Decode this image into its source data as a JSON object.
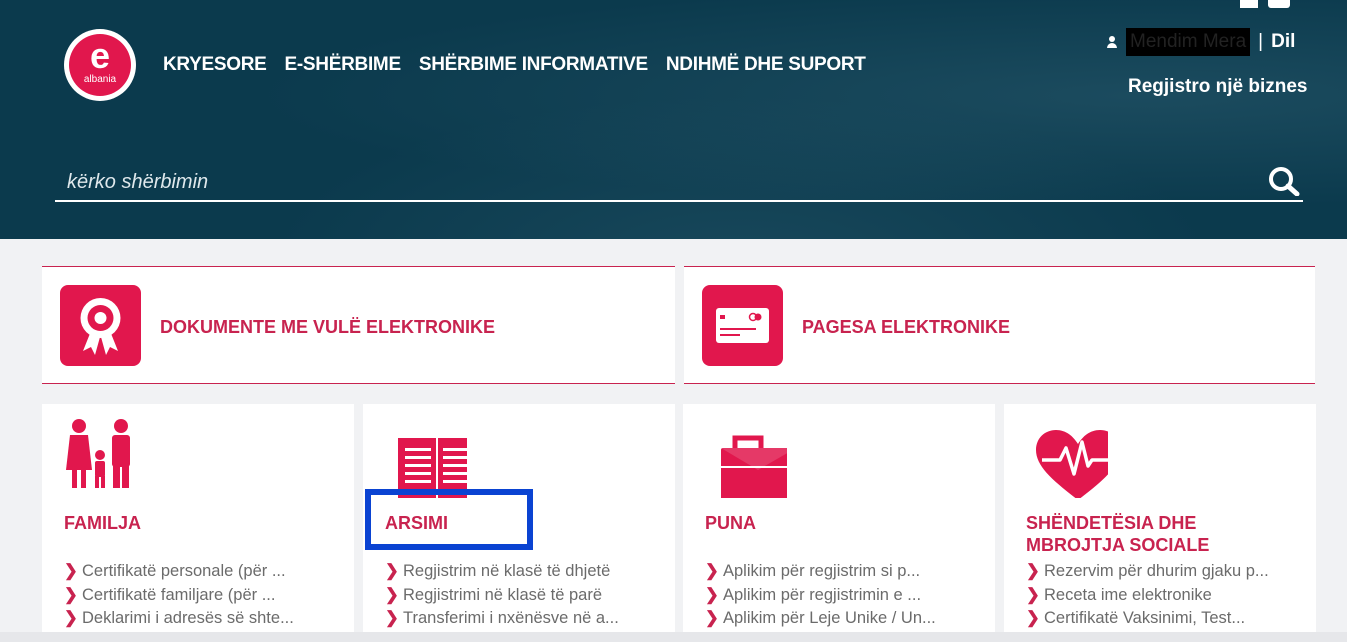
{
  "header": {
    "logo": {
      "letter": "e",
      "sub": "albania"
    },
    "nav": [
      "KRYESORE",
      "E-SHËRBIME",
      "SHËRBIME INFORMATIVE",
      "NDIHMË DHE SUPORT"
    ],
    "user": {
      "name": "Mendim Mera",
      "separator": "|",
      "logout": "Dil"
    },
    "register_business": "Regjistro një biznes",
    "search": {
      "placeholder": "kërko shërbimin"
    }
  },
  "featured": [
    {
      "label": "DOKUMENTE ME VULË ELEKTRONIKE",
      "icon": "ribbon-badge-icon"
    },
    {
      "label": "PAGESA ELEKTRONIKE",
      "icon": "credit-card-icon"
    }
  ],
  "categories": [
    {
      "title": "FAMILJA",
      "icon": "family-icon",
      "links": [
        "Certifikatë personale (për ...",
        "Certifikatë familjare (për ...",
        "Deklarimi i adresës së shte..."
      ]
    },
    {
      "title": "ARSIMI",
      "icon": "open-book-icon",
      "links": [
        "Regjistrim në klasë të dhjetë",
        "Regjistrimi në klasë të parë",
        "Transferimi i nxënësve në a..."
      ]
    },
    {
      "title": "PUNA",
      "icon": "briefcase-icon",
      "links": [
        "Aplikim për regjistrim si p...",
        "Aplikim për regjistrimin e ...",
        "Aplikim për Leje Unike / Un..."
      ]
    },
    {
      "title": "SHËNDETËSIA DHE MBROJTJA SOCIALE",
      "icon": "heart-pulse-icon",
      "links": [
        "Rezervim për dhurim gjaku p...",
        "Receta ime elektronike",
        "Certifikatë Vaksinimi, Test..."
      ]
    }
  ],
  "colors": {
    "header_bg": "#0b3a4d",
    "accent": "#e1174d",
    "highlight": "#0a43d2"
  }
}
